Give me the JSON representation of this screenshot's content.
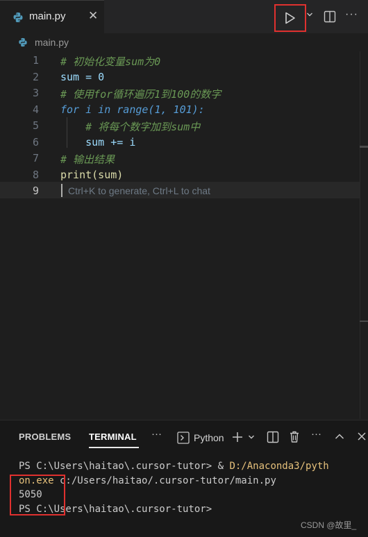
{
  "tab": {
    "filename": "main.py",
    "close_glyph": "✕"
  },
  "toolbar": {
    "run_icon": "play-icon",
    "more_glyph": "···"
  },
  "breadcrumb": {
    "label": "main.py"
  },
  "editor": {
    "lines": [
      {
        "n": "1",
        "text": "# 初始化变量sum为0"
      },
      {
        "n": "2",
        "text": "sum = 0"
      },
      {
        "n": "3",
        "text": "# 使用for循环遍历1到100的数字"
      },
      {
        "n": "4",
        "text": "for i in range(1, 101):"
      },
      {
        "n": "5",
        "text": "    # 将每个数字加到sum中"
      },
      {
        "n": "6",
        "text": "    sum += i"
      },
      {
        "n": "7",
        "text": "# 输出结果"
      },
      {
        "n": "8",
        "text": "print(sum)"
      },
      {
        "n": "9",
        "text": ""
      }
    ],
    "hint": "Ctrl+K to generate, Ctrl+L to chat",
    "colors": {
      "comment": "#6a9955",
      "keyword": "#569cd6",
      "number": "#b5cea8",
      "function": "#dcdcaa"
    }
  },
  "panel": {
    "tabs": {
      "problems": "PROBLEMS",
      "terminal": "TERMINAL"
    },
    "more_glyph": "···",
    "profile_label": "Python",
    "terminal": {
      "line1_prefix": "PS C:\\Users\\haitao\\.cursor-tutor> & ",
      "line1_exe": "D:/Anaconda3/pyth",
      "line2_exe": "on.exe",
      "line2_rest": " c:/Users/haitao/.cursor-tutor/main.py",
      "line3": "5050",
      "line4": "PS C:\\Users\\haitao\\.cursor-tutor>"
    }
  },
  "watermark": "CSDN @故里_",
  "accent_colors": {
    "highlight_box": "#e0312f",
    "python_icon": "#519aba"
  }
}
